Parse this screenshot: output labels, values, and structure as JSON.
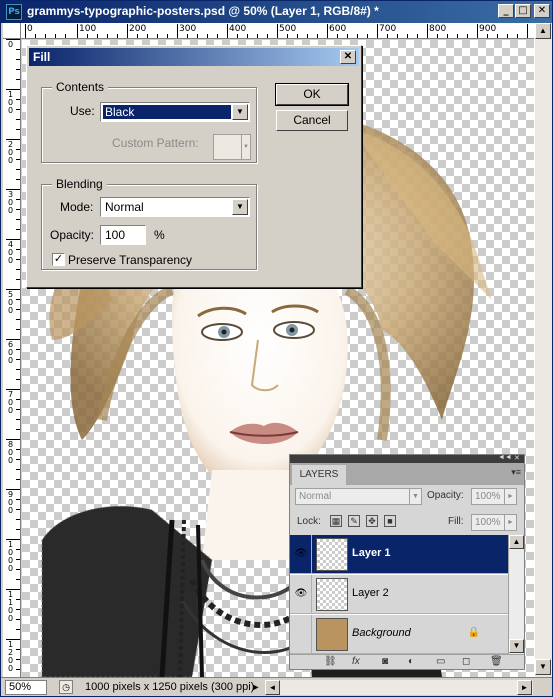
{
  "window": {
    "title": "grammys-typographic-posters.psd @ 50% (Layer 1, RGB/8#) *",
    "app_icon": "Ps",
    "buttons": [
      "_",
      "□",
      "✕"
    ]
  },
  "ruler": {
    "top_labels": [
      "0",
      "100",
      "200",
      "300",
      "400",
      "500",
      "600",
      "700",
      "800",
      "900"
    ],
    "left_labels": [
      "0",
      "1\n0\n0",
      "2\n0\n0",
      "3\n0\n0",
      "4\n0\n0",
      "5\n0\n0",
      "6\n0\n0",
      "7\n0\n0",
      "8\n0\n0",
      "9\n0\n0",
      "1\n0\n0\n0",
      "1\n1\n0\n0",
      "1\n2\n0\n0"
    ]
  },
  "status": {
    "zoom": "50%",
    "doc_info": "1000 pixels x 1250 pixels (300 ppi)"
  },
  "fill_dialog": {
    "title": "Fill",
    "contents_group": "Contents",
    "use_label": "Use:",
    "use_value": "Black",
    "custom_pattern_label": "Custom Pattern:",
    "blending_group": "Blending",
    "mode_label": "Mode:",
    "mode_value": "Normal",
    "opacity_label": "Opacity:",
    "opacity_value": "100",
    "opacity_unit": "%",
    "preserve_label": "Preserve Transparency",
    "preserve_checked": true,
    "ok_label": "OK",
    "cancel_label": "Cancel"
  },
  "layers_panel": {
    "tab": "LAYERS",
    "blend_mode": "Normal",
    "opacity_label": "Opacity:",
    "opacity_value": "100%",
    "lock_label": "Lock:",
    "fill_label": "Fill:",
    "fill_value": "100%",
    "layers": [
      {
        "name": "Layer 1",
        "selected": true,
        "visible": true
      },
      {
        "name": "Layer 2",
        "selected": false,
        "visible": true
      },
      {
        "name": "Background",
        "selected": false,
        "visible": false,
        "locked": true
      }
    ],
    "bottom_icons": [
      "link-icon",
      "fx-icon",
      "mask-icon",
      "adjustment-icon",
      "folder-icon",
      "new-layer-icon",
      "trash-icon"
    ]
  }
}
